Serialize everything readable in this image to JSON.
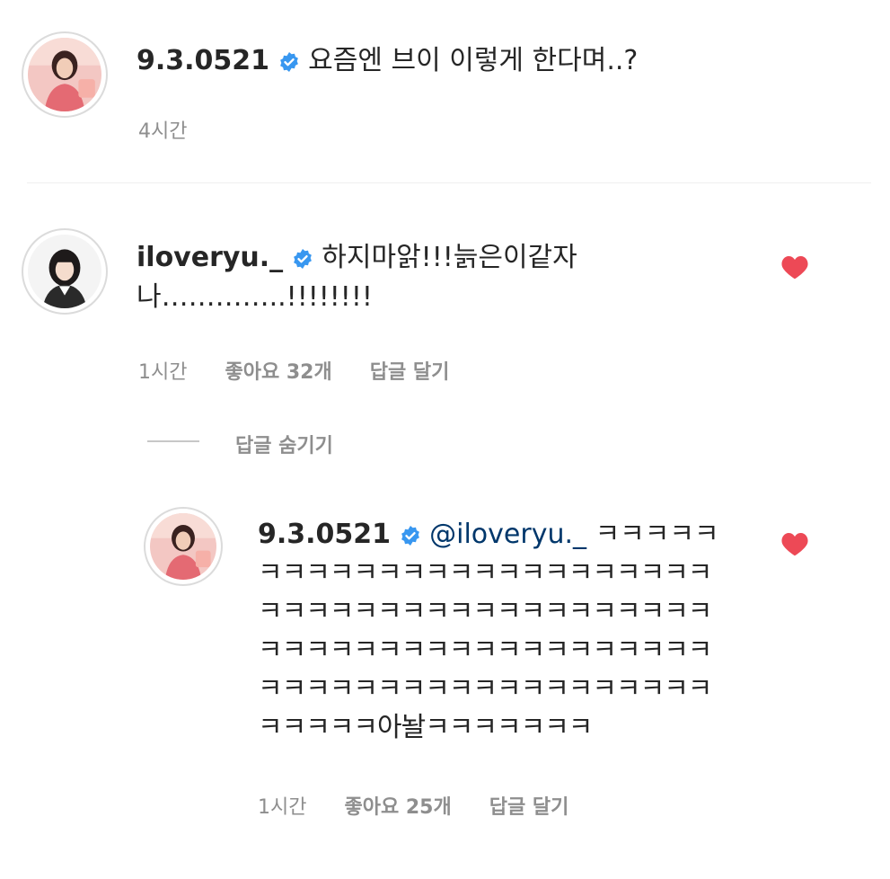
{
  "comments": [
    {
      "username": "9.3.0521",
      "verified": true,
      "text": "요즘엔 브이 이렇게 한다며..?",
      "time": "4시간"
    },
    {
      "username": "iloveryu._",
      "verified": true,
      "text_line1": "하지마앍!!!늙은이같자",
      "text_line2": "나…………..!!!!!!!!",
      "time": "1시간",
      "likes": "좋아요 32개",
      "reply_label": "답글 달기",
      "liked": true
    }
  ],
  "hide_replies_label": "답글 숨기기",
  "reply": {
    "username": "9.3.0521",
    "verified": true,
    "mention": "@iloveryu._",
    "text_line1": "ㅋㅋㅋㅋㅋ",
    "text_line2": "ㅋㅋㅋㅋㅋㅋㅋㅋㅋㅋㅋㅋㅋㅋㅋㅋㅋㅋㅋ",
    "text_line3": "ㅋㅋㅋㅋㅋㅋㅋㅋㅋㅋㅋㅋㅋㅋㅋㅋㅋㅋㅋ",
    "text_line4": "ㅋㅋㅋㅋㅋㅋㅋㅋㅋㅋㅋㅋㅋㅋㅋㅋㅋㅋㅋ",
    "text_line5": "ㅋㅋㅋㅋㅋㅋㅋㅋㅋㅋㅋㅋㅋㅋㅋㅋㅋㅋㅋ",
    "text_line6": "ㅋㅋㅋㅋㅋ아놜ㅋㅋㅋㅋㅋㅋㅋ",
    "time": "1시간",
    "likes": "좋아요 25개",
    "reply_label": "답글 달기",
    "liked": true
  },
  "colors": {
    "verified_blue": "#3897f0",
    "heart_red": "#ed4956",
    "meta_gray": "#8e8e8e"
  },
  "icons": [
    "verified-badge-icon",
    "heart-icon",
    "avatar"
  ]
}
